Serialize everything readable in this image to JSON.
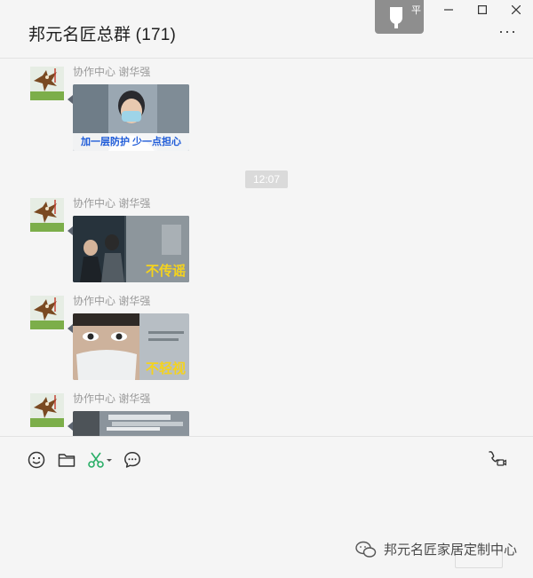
{
  "window": {
    "title": "邦元名匠总群 (171)",
    "pin_char": "平",
    "minimize_label": "—",
    "maximize_label": "□",
    "close_label": "✕",
    "more_label": "···"
  },
  "messages": [
    {
      "sender": "协作中心 谢华强",
      "thumb_caption": "加一层防护 少一点担心",
      "thumb_style": "mask-woman"
    },
    {
      "sender": "协作中心 谢华强",
      "thumb_caption": "不传谣",
      "thumb_style": "waiting-room"
    },
    {
      "sender": "协作中心 谢华强",
      "thumb_caption": "不轻视",
      "thumb_style": "mask-man"
    },
    {
      "sender": "协作中心 谢华强",
      "thumb_caption": "",
      "thumb_style": "office"
    }
  ],
  "timestamp": "12:07",
  "toolbar": {
    "icons": [
      "emoji-icon",
      "folder-icon",
      "scissors-icon",
      "chat-bubble-icon"
    ],
    "right_icon": "video-call-icon"
  },
  "watermark": {
    "text": "邦元名匠家居定制中心"
  },
  "colors": {
    "background": "#f5f5f5",
    "accent_green": "#2aae67",
    "timestamp_bg": "#dadada",
    "caption_yellow": "#f5d31c",
    "caption_blue": "#1e5bd8"
  }
}
